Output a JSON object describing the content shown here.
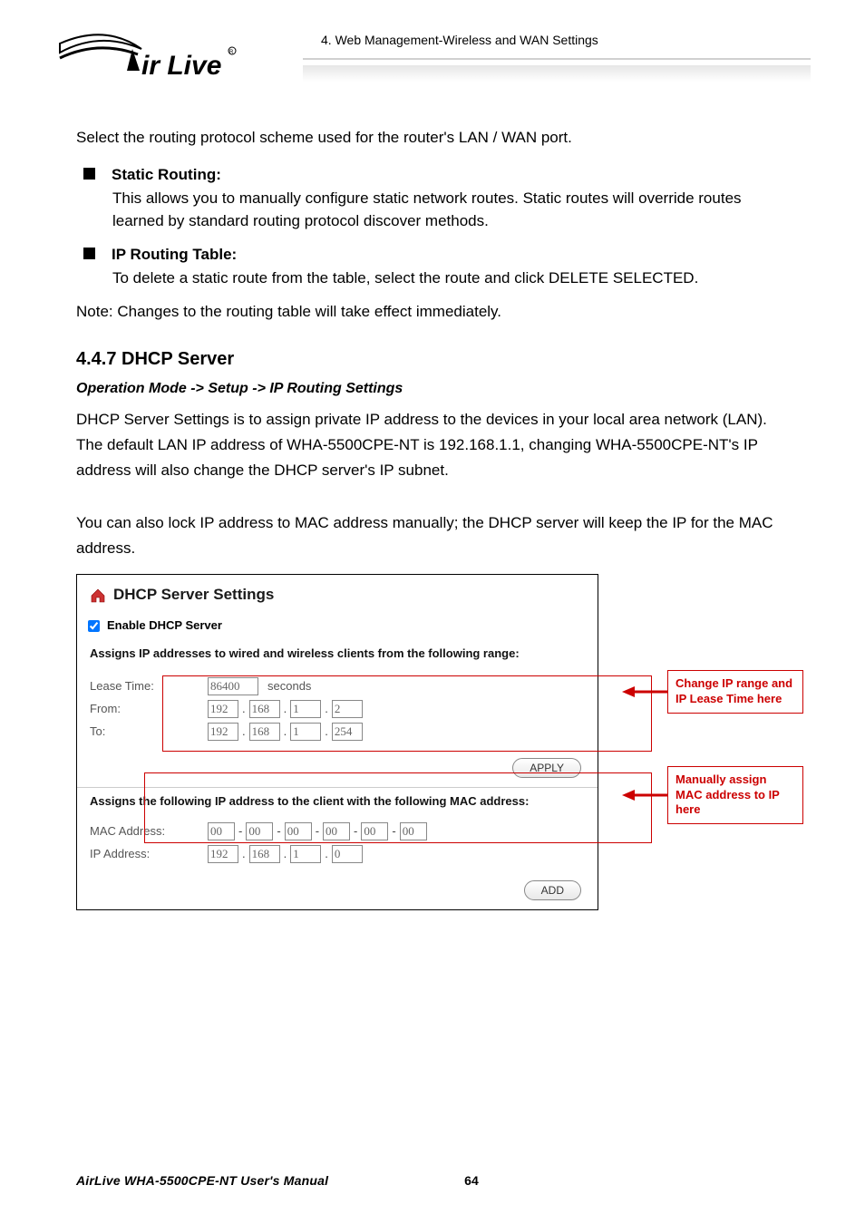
{
  "header": {
    "brand_text": "ir Live",
    "chapter": "4.  Web  Management-Wireless  and  WAN  Settings"
  },
  "intro": "Select the routing protocol scheme used for the router's LAN / WAN port.",
  "bullets": [
    {
      "title": "Static Routing:",
      "body": "This allows you to manually configure static network routes. Static routes will override routes learned by standard routing protocol discover methods."
    },
    {
      "title": "IP Routing Table:",
      "body": "To delete a static route from the table, select the route and click DELETE SELECTED."
    }
  ],
  "note": "Note: Changes to the routing table will take effect immediately.",
  "section": {
    "number": "4.4.7 DHCP Server",
    "breadcrumb": "Operation Mode -> Setup -> IP Routing Settings",
    "p1": "DHCP Server Settings is to assign private IP address to the devices in your local area network (LAN).    The default LAN IP address of WHA-5500CPE-NT is 192.168.1.1, changing WHA-5500CPE-NT's IP address will also change the DHCP server's IP subnet.",
    "p2": "You can also lock IP address to MAC address manually; the DHCP server will keep the IP for the MAC address."
  },
  "panel": {
    "title": "DHCP Server Settings",
    "enable_label": "Enable DHCP Server",
    "enable_checked": true,
    "range_label": "Assigns IP addresses to wired and wireless clients from the following range:",
    "lease_label": "Lease Time:",
    "lease_value": "86400",
    "seconds_label": "seconds",
    "from_label": "From:",
    "from_ip": [
      "192",
      "168",
      "1",
      "2"
    ],
    "to_label": "To:",
    "to_ip": [
      "192",
      "168",
      "1",
      "254"
    ],
    "apply_label": "APPLY",
    "mac_section_label": "Assigns the following IP address to the client with the following MAC address:",
    "mac_label": "MAC Address:",
    "mac": [
      "00",
      "00",
      "00",
      "00",
      "00",
      "00"
    ],
    "ipaddr_label": "IP Address:",
    "ipaddr": [
      "192",
      "168",
      "1",
      "0"
    ],
    "add_label": "ADD"
  },
  "callouts": {
    "c1": "Change IP range and IP Lease Time here",
    "c2": "Manually assign MAC address to IP here"
  },
  "footer": {
    "manual": "AirLive WHA-5500CPE-NT User's Manual",
    "page": "64"
  }
}
